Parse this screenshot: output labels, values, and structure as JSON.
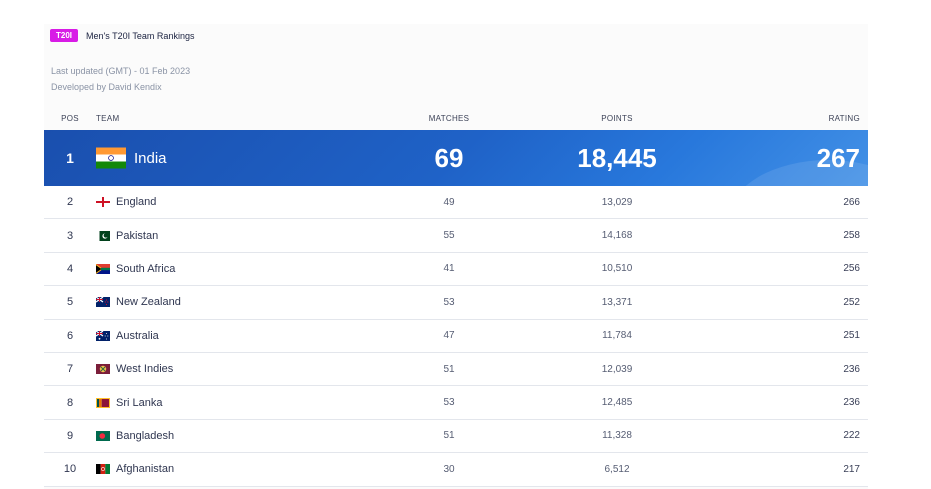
{
  "header": {
    "badge": "T20I",
    "title": "Men's T20I Team Rankings",
    "last_updated": "Last updated (GMT) - 01 Feb 2023",
    "developer": "Developed by David Kendix"
  },
  "columns": {
    "pos": "POS",
    "team": "TEAM",
    "matches": "MATCHES",
    "points": "POINTS",
    "rating": "RATING"
  },
  "top": {
    "pos": "1",
    "team": "India",
    "flag": "india-flag-icon",
    "matches": "69",
    "points": "18,445",
    "rating": "267"
  },
  "rows": [
    {
      "pos": "2",
      "team": "England",
      "flag": "england-flag-icon",
      "matches": "49",
      "points": "13,029",
      "rating": "266"
    },
    {
      "pos": "3",
      "team": "Pakistan",
      "flag": "pakistan-flag-icon",
      "matches": "55",
      "points": "14,168",
      "rating": "258"
    },
    {
      "pos": "4",
      "team": "South Africa",
      "flag": "south-africa-flag-icon",
      "matches": "41",
      "points": "10,510",
      "rating": "256"
    },
    {
      "pos": "5",
      "team": "New Zealand",
      "flag": "new-zealand-flag-icon",
      "matches": "53",
      "points": "13,371",
      "rating": "252"
    },
    {
      "pos": "6",
      "team": "Australia",
      "flag": "australia-flag-icon",
      "matches": "47",
      "points": "11,784",
      "rating": "251"
    },
    {
      "pos": "7",
      "team": "West Indies",
      "flag": "west-indies-flag-icon",
      "matches": "51",
      "points": "12,039",
      "rating": "236"
    },
    {
      "pos": "8",
      "team": "Sri Lanka",
      "flag": "sri-lanka-flag-icon",
      "matches": "53",
      "points": "12,485",
      "rating": "236"
    },
    {
      "pos": "9",
      "team": "Bangladesh",
      "flag": "bangladesh-flag-icon",
      "matches": "51",
      "points": "11,328",
      "rating": "222"
    },
    {
      "pos": "10",
      "team": "Afghanistan",
      "flag": "afghanistan-flag-icon",
      "matches": "30",
      "points": "6,512",
      "rating": "217"
    }
  ],
  "colors": {
    "badge": "#d81be6",
    "top_row": "#1f62c7"
  }
}
